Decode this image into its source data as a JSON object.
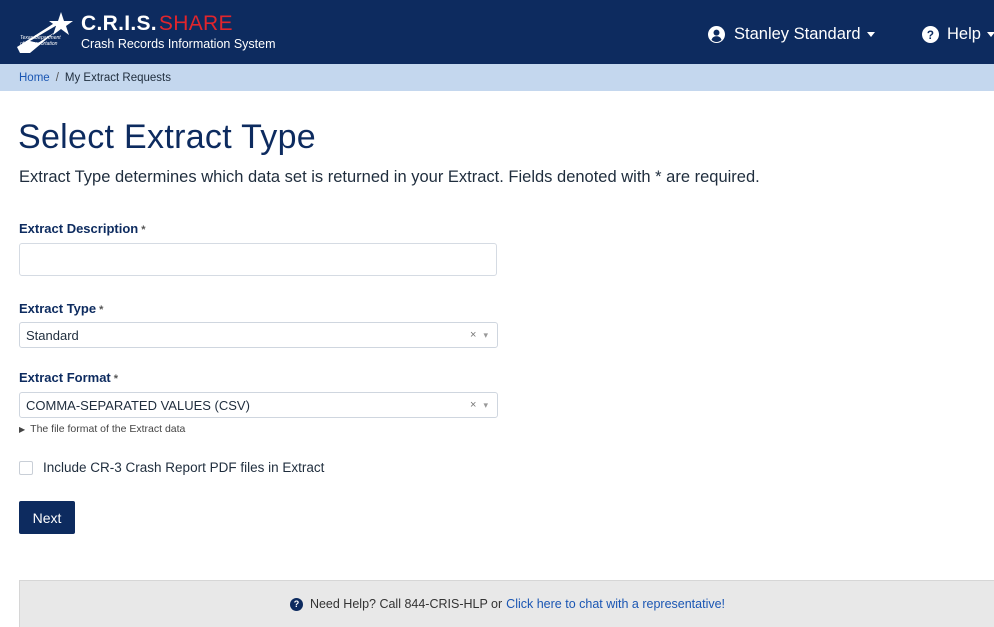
{
  "header": {
    "brand_main": "C.R.I.S.",
    "brand_accent": "SHARE",
    "brand_sub": "Crash Records Information System",
    "dept_text": "Texas Department of Transportation",
    "user_name": "Stanley Standard",
    "help_label": "Help",
    "colors": {
      "navbar": "#0d2b5f",
      "accent": "#e1252c"
    },
    "icons": {
      "user": "user-circle-icon",
      "help": "question-circle-icon",
      "logo": "star-swoosh-logo"
    }
  },
  "breadcrumb": {
    "home": "Home",
    "separator": "/",
    "current": "My Extract Requests"
  },
  "page": {
    "title": "Select Extract Type",
    "intro": "Extract Type determines which data set is returned in your Extract. Fields denoted with * are required."
  },
  "form": {
    "description": {
      "label": "Extract Description",
      "required_mark": "*",
      "value": ""
    },
    "type": {
      "label": "Extract Type",
      "required_mark": "*",
      "value": "Standard",
      "clear": "×",
      "arrow": "▾"
    },
    "format": {
      "label": "Extract Format",
      "required_mark": "*",
      "value": "COMMA-SEPARATED VALUES (CSV)",
      "clear": "×",
      "arrow": "▾",
      "hint": "The file format of the Extract data",
      "hint_marker": "▶"
    },
    "include_pdf": {
      "label": "Include CR-3 Crash Report PDF files in Extract",
      "checked": false
    },
    "next_label": "Next"
  },
  "footer": {
    "help_icon_glyph": "?",
    "text": "Need Help? Call 844-CRIS-HLP or",
    "link": "Click here to chat with a representative!"
  }
}
